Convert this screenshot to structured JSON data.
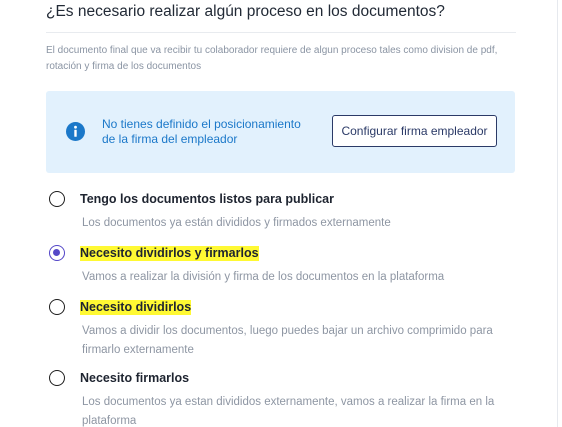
{
  "section": {
    "title": "¿Es necesario realizar algún proceso en los documentos?",
    "description": "El documento final que va recibir tu colaborador requiere de algun proceso tales como division de pdf, rotación y firma de los documentos"
  },
  "info_box": {
    "icon": "info-icon",
    "message": "No tienes definido el posicionamiento de la firma del empleador",
    "button_label": "Configurar firma empleador",
    "background_color": "#e2f1fd",
    "text_color": "#1b78c9"
  },
  "options": [
    {
      "label": "Tengo los documentos listos para publicar",
      "description": "Los documentos ya están divididos y firmados externamente",
      "selected": false,
      "highlighted": false
    },
    {
      "label": "Necesito dividirlos y firmarlos",
      "description": "Vamos a realizar la división y firma de los documentos en la plataforma",
      "selected": true,
      "highlighted": true
    },
    {
      "label": "Necesito dividirlos",
      "description": "Vamos a dividir los documentos, luego puedes bajar un archivo comprimido para firmarlo externamente",
      "selected": false,
      "highlighted": true
    },
    {
      "label": "Necesito firmarlos",
      "description": "Los documentos ya estan divididos externamente, vamos a realizar la firma en la plataforma",
      "selected": false,
      "highlighted": false
    }
  ],
  "colors": {
    "accent": "#5548c8",
    "highlight": "#fff933",
    "button_border": "#2b3a67"
  }
}
